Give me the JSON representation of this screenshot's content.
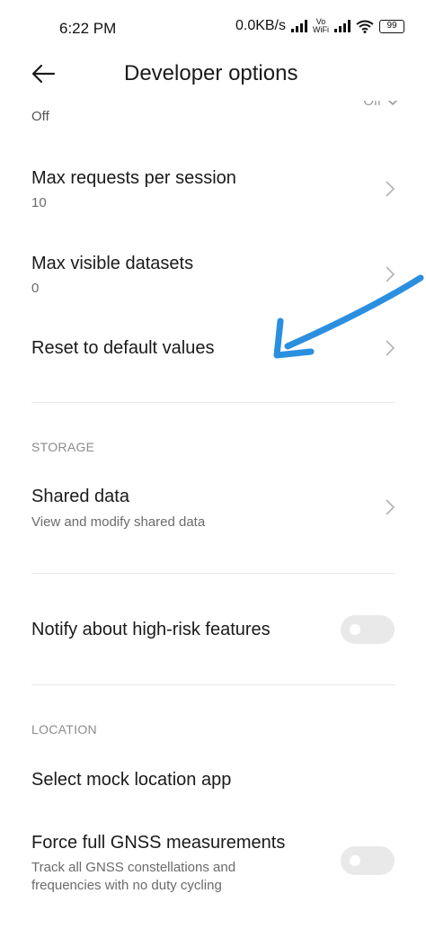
{
  "status_bar": {
    "time": "6:22 PM",
    "net_speed": "0.0KB/s",
    "vowifi_top": "Vo",
    "vowifi_bottom": "WiFi",
    "battery": "99"
  },
  "header": {
    "title": "Developer options"
  },
  "partial_row": {
    "value": "Off",
    "switch_label": "Off"
  },
  "rows": {
    "max_requests": {
      "title": "Max requests per session",
      "value": "10"
    },
    "max_datasets": {
      "title": "Max visible datasets",
      "value": "0"
    },
    "reset": {
      "title": "Reset to default values"
    }
  },
  "storage": {
    "header": "STORAGE",
    "shared_data": {
      "title": "Shared data",
      "subtitle": "View and modify shared data"
    }
  },
  "high_risk": {
    "title": "Notify about high-risk features",
    "toggle_on": false
  },
  "location": {
    "header": "LOCATION",
    "mock_app": {
      "title": "Select mock location app"
    },
    "gnss": {
      "title": "Force full GNSS measurements",
      "subtitle_line1": "Track all GNSS constellations and",
      "subtitle_line2": "frequencies with no duty cycling",
      "toggle_on": false
    }
  },
  "colors": {
    "annotation_arrow": "#2b8fe0",
    "toggle_off": "#e9e9ea"
  }
}
